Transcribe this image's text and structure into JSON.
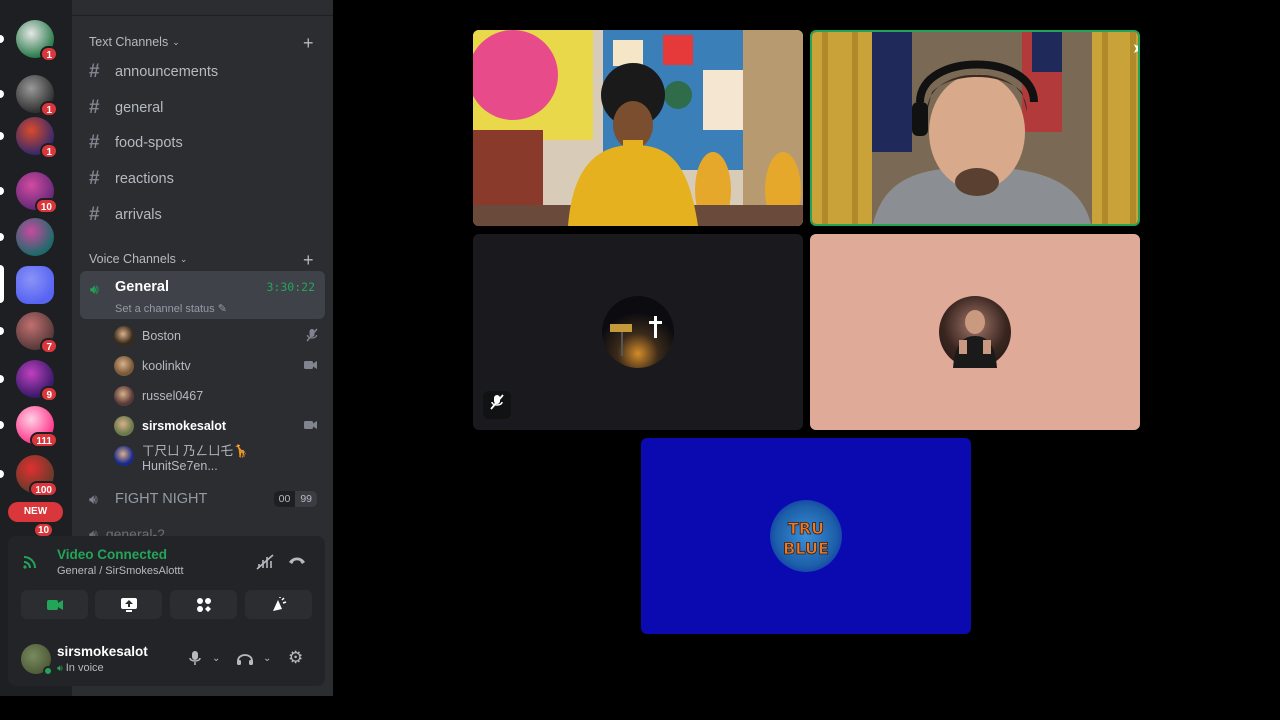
{
  "servers": [
    {
      "id": "s1",
      "badge": "1",
      "colors": [
        "#2e7d4f",
        "#e6e6e6"
      ]
    },
    {
      "id": "s2",
      "badge": "1",
      "colors": [
        "#333333",
        "#999999"
      ]
    },
    {
      "id": "s3",
      "badge": "1",
      "colors": [
        "#3a2a6a",
        "#d94b2b"
      ]
    },
    {
      "id": "s4",
      "badge": "10",
      "colors": [
        "#6a2a7a",
        "#d14ba0"
      ]
    },
    {
      "id": "s5",
      "badge": "",
      "colors": [
        "#1d6a6a",
        "#c84aa0"
      ]
    },
    {
      "id": "s6",
      "badge": "",
      "colors": [
        "#5865f2",
        "#8a93f7"
      ]
    },
    {
      "id": "s7",
      "badge": "7",
      "colors": [
        "#5a3a3a",
        "#c07070"
      ]
    },
    {
      "id": "s8",
      "badge": "9",
      "colors": [
        "#3a1a6a",
        "#c040c0"
      ]
    },
    {
      "id": "s9",
      "badge": "111",
      "colors": [
        "#ff3c8e",
        "#ffd1e6"
      ]
    },
    {
      "id": "s10",
      "badge": "100",
      "colors": [
        "#6a3a2a",
        "#e03030"
      ]
    }
  ],
  "rail": {
    "new_label": "NEW",
    "new_badge": "10"
  },
  "text_channels": {
    "header": "Text Channels",
    "items": [
      "announcements",
      "general",
      "food-spots",
      "reactions",
      "arrivals"
    ]
  },
  "voice_channels": {
    "header": "Voice Channels",
    "active": {
      "name": "General",
      "timer": "3:30:22",
      "status": "Set a channel status",
      "users": [
        {
          "name": "Boston",
          "icon": "mic-muted-icon",
          "bold": false,
          "avatar": "#3a2a1a"
        },
        {
          "name": "koolinktv",
          "icon": "camera-icon",
          "bold": false,
          "avatar": "#7a5a3a"
        },
        {
          "name": "russel0467",
          "icon": "",
          "bold": false,
          "avatar": "#5a3a3a"
        },
        {
          "name": "sirsmokesalot",
          "icon": "camera-icon",
          "bold": true,
          "avatar": "#6a7a4a"
        },
        {
          "name": "ㄒ尺ㄩ 乃ㄥㄩ乇🦒HunitSe7en...",
          "icon": "",
          "bold": false,
          "avatar": "#1a2a8a"
        }
      ]
    },
    "fight_night": {
      "name": "FIGHT NIGHT",
      "count_a": "00",
      "count_b": "99"
    },
    "ghost": "general-2"
  },
  "voice_panel": {
    "title": "Video Connected",
    "subtitle": "General / SirSmokesAlottt",
    "buttons": [
      "camera-button",
      "screenshare-button",
      "activities-button",
      "soundboard-button"
    ]
  },
  "user": {
    "name": "sirsmokesalot",
    "status": "In voice"
  },
  "tiles": [
    {
      "id": "koolinktv",
      "kind": "video-room",
      "speaking": false
    },
    {
      "id": "boston-cam",
      "kind": "video-office",
      "speaking": true
    },
    {
      "id": "boston",
      "kind": "avatar-dark",
      "muted": true
    },
    {
      "id": "russel0467",
      "kind": "avatar-pink"
    },
    {
      "id": "trublue",
      "kind": "avatar-blue"
    }
  ],
  "colors": {
    "accent_green": "#23a559",
    "tile_dark": "#1a1a1e",
    "tile_pink": "#e0aa98",
    "tile_blue": "#0a0ab0"
  }
}
